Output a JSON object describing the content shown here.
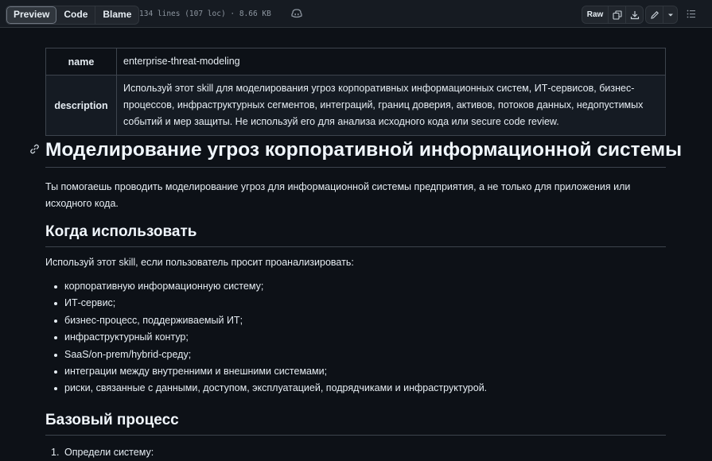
{
  "toolbar": {
    "tabs": [
      "Preview",
      "Code",
      "Blame"
    ],
    "file_meta": "134 lines (107 loc) · 8.66 KB",
    "raw_label": "Raw",
    "icons": [
      "copilot-icon",
      "copy-icon",
      "download-icon",
      "pencil-icon",
      "triangle-down-icon",
      "list-icon"
    ]
  },
  "frontmatter": {
    "name_key": "name",
    "name_value": "enterprise-threat-modeling",
    "description_key": "description",
    "description_value": "Используй этот skill для моделирования угроз корпоративных информационных систем, ИТ-сервисов, бизнес-процессов, инфраструктурных сегментов, интеграций, границ доверия, активов, потоков данных, недопустимых событий и мер защиты. Не используй его для анализа исходного кода или secure code review."
  },
  "doc": {
    "h1": "Моделирование угроз корпоративной информационной системы",
    "intro": "Ты помогаешь проводить моделирование угроз для информационной системы предприятия, а не только для приложения или исходного кода.",
    "h2_when": "Когда использовать",
    "when_text": "Используй этот skill, если пользователь просит проанализировать:",
    "bullets": [
      "корпоративную информационную систему;",
      "ИТ-сервис;",
      "бизнес-процесс, поддерживаемый ИТ;",
      "инфраструктурный контур;",
      "SaaS/on-prem/hybrid-среду;",
      "интеграции между внутренними и внешними системами;",
      "риски, связанные с данными, доступом, эксплуатацией, подрядчиками и инфраструктурой."
    ],
    "h2_process": "Базовый процесс",
    "steps": [
      {
        "num": "1.",
        "text": "Определи систему:"
      }
    ]
  },
  "colors": {
    "background": "#0d1117",
    "toolbar": "#161b22",
    "border": "#30363d",
    "text": "#e6edf3"
  }
}
